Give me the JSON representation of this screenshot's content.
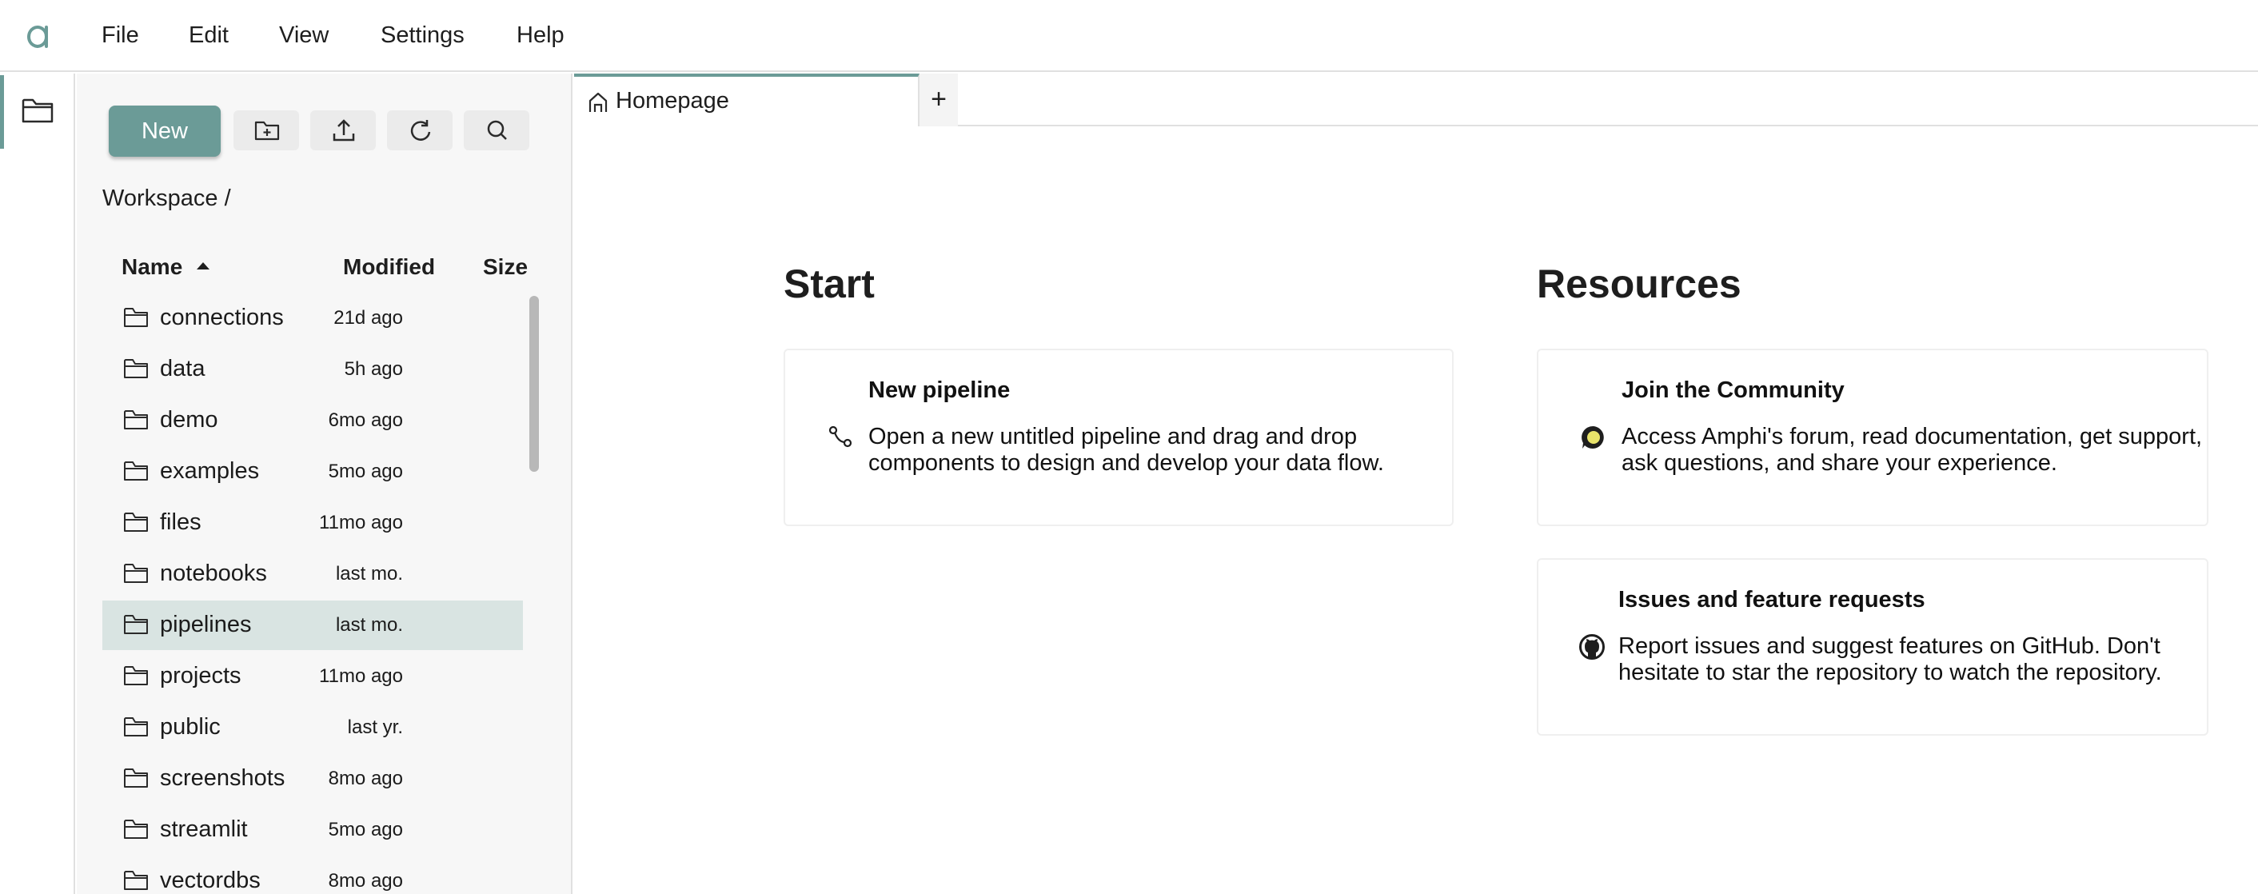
{
  "menubar": {
    "items": [
      "File",
      "Edit",
      "View",
      "Settings",
      "Help"
    ]
  },
  "filebrowser": {
    "new_label": "New",
    "breadcrumb": "Workspace /",
    "columns": {
      "name": "Name",
      "modified": "Modified",
      "size": "Size"
    },
    "files": [
      {
        "name": "connections",
        "modified": "21d ago"
      },
      {
        "name": "data",
        "modified": "5h ago"
      },
      {
        "name": "demo",
        "modified": "6mo ago"
      },
      {
        "name": "examples",
        "modified": "5mo ago"
      },
      {
        "name": "files",
        "modified": "11mo ago"
      },
      {
        "name": "notebooks",
        "modified": "last mo."
      },
      {
        "name": "pipelines",
        "modified": "last mo.",
        "selected": true
      },
      {
        "name": "projects",
        "modified": "11mo ago"
      },
      {
        "name": "public",
        "modified": "last yr."
      },
      {
        "name": "screenshots",
        "modified": "8mo ago"
      },
      {
        "name": "streamlit",
        "modified": "5mo ago"
      },
      {
        "name": "vectordbs",
        "modified": "8mo ago"
      }
    ]
  },
  "tabs": {
    "home_label": "Homepage",
    "add_label": "+"
  },
  "home": {
    "start_title": "Start",
    "resources_title": "Resources",
    "new_pipeline": {
      "title": "New pipeline",
      "desc": "Open a new untitled pipeline and drag and drop components to design and develop your data flow."
    },
    "community": {
      "title": "Join the Community",
      "desc": "Access Amphi's forum, read documentation, get support, ask questions, and share your experience."
    },
    "issues": {
      "title": "Issues and feature requests",
      "desc": "Report issues and suggest features on GitHub. Don't hesitate to star the repository to watch the repository."
    }
  },
  "colors": {
    "accent": "#6b9b97",
    "selected_row": "#d9e4e2",
    "panel_bg": "#f7f7f7"
  }
}
